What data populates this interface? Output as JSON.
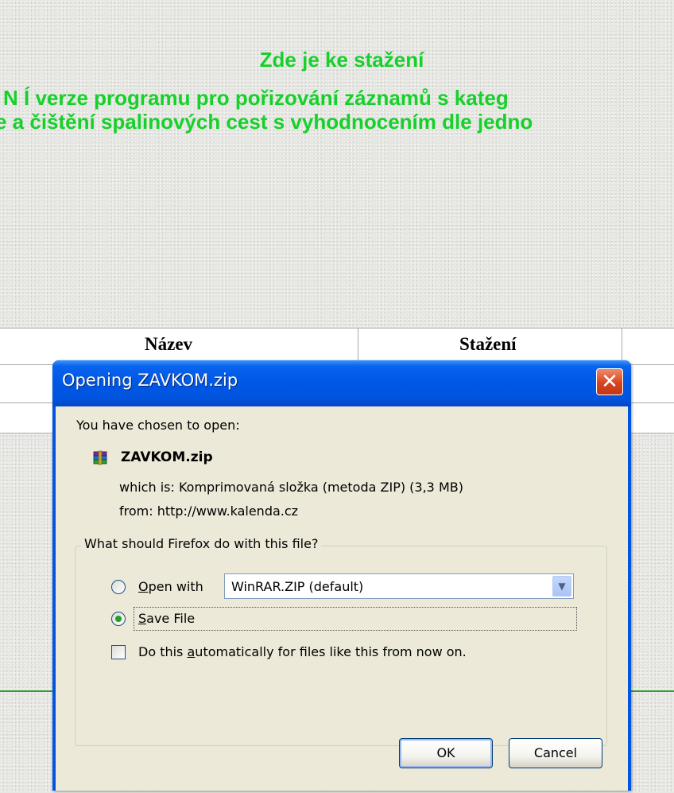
{
  "page": {
    "heading_line1": "Zde je ke stažení",
    "heading_line2": "N Í verze    programu pro pořizování záznamů s kateg",
    "heading_line3": "e a čištění spalinových cest s vyhodnocením dle jedno",
    "table": {
      "headers": [
        "Název",
        "Stažení"
      ]
    },
    "colors": {
      "heading": "#16d12a"
    }
  },
  "dialog": {
    "title": "Opening ZAVKOM.zip",
    "close_icon": "close-icon",
    "chosen_text": "You have chosen to open:",
    "file_icon": "winrar-archive-icon",
    "filename": "ZAVKOM.zip",
    "which_is": "which is:  Komprimovaná složka (metoda ZIP) (3,3 MB)",
    "from": "from:  http://www.kalenda.cz",
    "group_label": "What should Firefox do with this file?",
    "open_with": {
      "label_prefix": "O",
      "label_rest": "pen with",
      "selected": false
    },
    "open_with_app": "WinRAR.ZIP (default)",
    "save_file": {
      "label_prefix": "S",
      "label_rest": "ave File",
      "selected": true
    },
    "auto_checkbox": {
      "label_before": "Do this ",
      "label_accel": "a",
      "label_after": "utomatically for files like this from now on.",
      "checked": false
    },
    "ok_label": "OK",
    "cancel_label": "Cancel"
  }
}
